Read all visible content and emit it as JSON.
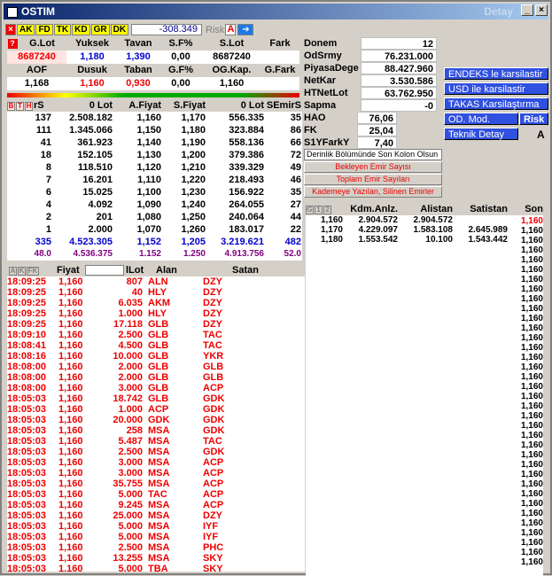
{
  "window": {
    "title": "OSTIM",
    "right_title": "Detay"
  },
  "toolbar": {
    "buttons": [
      "AK",
      "FD",
      "TK",
      "KD",
      "GR",
      "DK"
    ],
    "price": "-308.349",
    "risk_label": "Risk",
    "risk_value": "A"
  },
  "summary": {
    "h1": [
      "G.Lot",
      "Yuksek",
      "Tavan",
      "S.F%",
      "S.Lot",
      "Fark"
    ],
    "v1": [
      "8687240",
      "1,180",
      "1,390",
      "0,00",
      "8687240",
      ""
    ],
    "h2": [
      "AOF",
      "Dusuk",
      "Taban",
      "G.F%",
      "OG.Kap.",
      "G.Fark"
    ],
    "v2": [
      "1,168",
      "1,160",
      "0,930",
      "0,00",
      "1,160",
      ""
    ]
  },
  "depth": {
    "headers": [
      "rS",
      "0 Lot",
      "A.Fiyat",
      "S.Fiyat",
      "0 Lot",
      "SEmirS"
    ],
    "rows": [
      [
        "137",
        "2.508.182",
        "1,160",
        "1,170",
        "556.335",
        "35"
      ],
      [
        "111",
        "1.345.066",
        "1,150",
        "1,180",
        "323.884",
        "86"
      ],
      [
        "41",
        "361.923",
        "1,140",
        "1,190",
        "558.136",
        "66"
      ],
      [
        "18",
        "152.105",
        "1,130",
        "1,200",
        "379.386",
        "72"
      ],
      [
        "8",
        "118.510",
        "1,120",
        "1,210",
        "339.329",
        "49"
      ],
      [
        "7",
        "16.201",
        "1,110",
        "1,220",
        "218.493",
        "46"
      ],
      [
        "6",
        "15.025",
        "1,100",
        "1,230",
        "156.922",
        "35"
      ],
      [
        "4",
        "4.092",
        "1,090",
        "1,240",
        "264.055",
        "27"
      ],
      [
        "2",
        "201",
        "1,080",
        "1,250",
        "240.064",
        "44"
      ],
      [
        "1",
        "2.000",
        "1,070",
        "1,260",
        "183.017",
        "22"
      ]
    ],
    "total": [
      "335",
      "4.523.305",
      "1,152",
      "1,205",
      "3.219.621",
      "482"
    ],
    "avg": [
      "48.0",
      "4.536.375",
      "1.152",
      "1.250",
      "4.913.756",
      "52.0"
    ]
  },
  "trades": {
    "headers": [
      "Fiyat",
      "lLot",
      "Alan",
      "Satan"
    ],
    "rows": [
      [
        "18:09:25",
        "1,160",
        "807",
        "ALN",
        "DZY"
      ],
      [
        "18:09:25",
        "1,160",
        "40",
        "HLY",
        "DZY"
      ],
      [
        "18:09:25",
        "1,160",
        "6.035",
        "AKM",
        "DZY"
      ],
      [
        "18:09:25",
        "1,160",
        "1.000",
        "HLY",
        "DZY"
      ],
      [
        "18:09:25",
        "1,160",
        "17.118",
        "GLB",
        "DZY"
      ],
      [
        "18:09:10",
        "1,160",
        "2.500",
        "GLB",
        "TAC"
      ],
      [
        "18:08:41",
        "1,160",
        "4.500",
        "GLB",
        "TAC"
      ],
      [
        "18:08:16",
        "1,160",
        "10.000",
        "GLB",
        "YKR"
      ],
      [
        "18:08:00",
        "1,160",
        "2.000",
        "GLB",
        "GLB"
      ],
      [
        "18:08:00",
        "1,160",
        "2.000",
        "GLB",
        "GLB"
      ],
      [
        "18:08:00",
        "1,160",
        "3.000",
        "GLB",
        "ACP"
      ],
      [
        "18:05:03",
        "1,160",
        "18.742",
        "GLB",
        "GDK"
      ],
      [
        "18:05:03",
        "1,160",
        "1.000",
        "ACP",
        "GDK"
      ],
      [
        "18:05:03",
        "1,160",
        "20.000",
        "GDK",
        "GDK"
      ],
      [
        "18:05:03",
        "1,160",
        "258",
        "MSA",
        "GDK"
      ],
      [
        "18:05:03",
        "1,160",
        "5.487",
        "MSA",
        "TAC"
      ],
      [
        "18:05:03",
        "1,160",
        "2.500",
        "MSA",
        "GDK"
      ],
      [
        "18:05:03",
        "1,160",
        "3.000",
        "MSA",
        "ACP"
      ],
      [
        "18:05:03",
        "1,160",
        "3.000",
        "MSA",
        "ACP"
      ],
      [
        "18:05:03",
        "1,160",
        "35.755",
        "MSA",
        "ACP"
      ],
      [
        "18:05:03",
        "1,160",
        "5.000",
        "TAC",
        "ACP"
      ],
      [
        "18:05:03",
        "1,160",
        "9.245",
        "MSA",
        "ACP"
      ],
      [
        "18:05:03",
        "1,160",
        "25.000",
        "MSA",
        "DZY"
      ],
      [
        "18:05:03",
        "1,160",
        "5.000",
        "MSA",
        "IYF"
      ],
      [
        "18:05:03",
        "1,160",
        "5.000",
        "MSA",
        "IYF"
      ],
      [
        "18:05:03",
        "1,160",
        "2.500",
        "MSA",
        "PHC"
      ],
      [
        "18:05:03",
        "1,160",
        "13.255",
        "MSA",
        "SKY"
      ],
      [
        "18:05:03",
        "1,160",
        "5.000",
        "TBA",
        "SKY"
      ]
    ]
  },
  "info": {
    "rows": [
      [
        "Donem",
        "12"
      ],
      [
        "OdSrmy",
        "76.231.000"
      ],
      [
        "PiyasaDege",
        "88.427.960"
      ],
      [
        "NetKar",
        "3.530.586"
      ],
      [
        "HTNetLot",
        "63.762.950"
      ],
      [
        "Sapma",
        "-0"
      ]
    ],
    "rows2": [
      [
        "HAO",
        "76,06"
      ],
      [
        "FK",
        "25,04"
      ],
      [
        "S1YFarkY",
        "7,40"
      ]
    ]
  },
  "buttons": {
    "endeks": "ENDEKS le karsilastir",
    "usd": "USD ile karsilastir",
    "takas": "TAKAS Karsilaştırma",
    "od": "OD. Mod.",
    "risk": "Risk",
    "teknik": "Teknik Detay",
    "teknik_val": "A"
  },
  "panel": {
    "derinlik": "Derinlik Bölümünde Son Kolon Olsun",
    "bekleyen": "Bekleyen Emir Sayısı",
    "toplam": "Toplam Emir Sayıları",
    "kademe": "Kademeye Yazılan, Silinen Emirler"
  },
  "kdm": {
    "headers": [
      "Kdm.Anlz.",
      "Alistan",
      "Satistan",
      "Son"
    ],
    "rows": [
      [
        "1,160",
        "2.904.572",
        "2.904.572",
        ""
      ],
      [
        "1,170",
        "4.229.097",
        "1.583.108",
        "2.645.989"
      ],
      [
        "1,180",
        "1.553.542",
        "10.100",
        "1.543.442"
      ]
    ],
    "son_first": "1,160",
    "son": "1,160"
  }
}
